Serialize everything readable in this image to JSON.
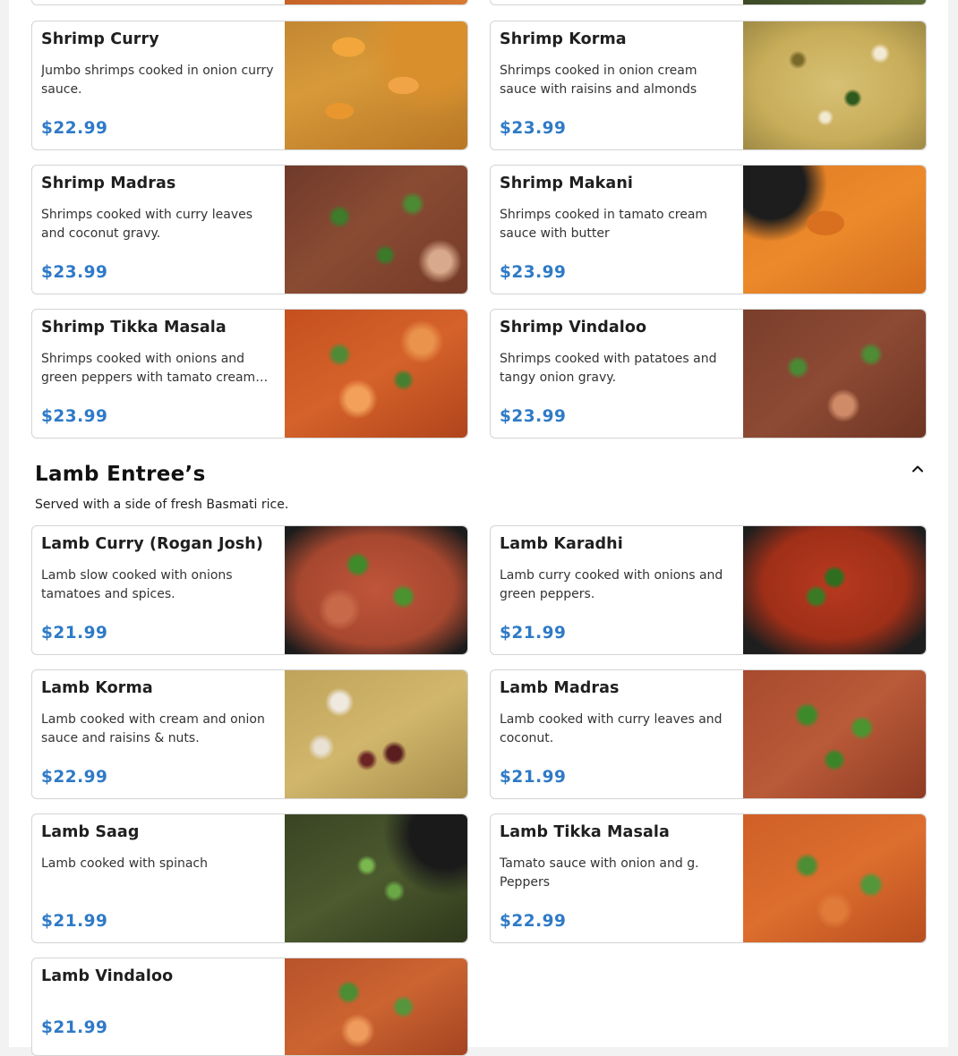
{
  "shrimp_items": [
    {
      "name": "Shrimp Curry",
      "desc": "Jumbo shrimps cooked in onion curry sauce.",
      "price": "$22.99",
      "photo": "shrimp-curry-photo"
    },
    {
      "name": "Shrimp Korma",
      "desc": "Shrimps cooked in onion cream sauce with raisins and almonds",
      "price": "$23.99",
      "photo": "shrimp-korma-photo"
    },
    {
      "name": "Shrimp Madras",
      "desc": "Shrimps cooked with curry leaves and coconut gravy.",
      "price": "$23.99",
      "photo": "shrimp-madras-photo"
    },
    {
      "name": "Shrimp Makani",
      "desc": "Shrimps cooked in tamato cream sauce with butter",
      "price": "$23.99",
      "photo": "shrimp-makani-photo"
    },
    {
      "name": "Shrimp Tikka Masala",
      "desc": "Shrimps cooked with onions and green peppers with tamato cream sauce",
      "price": "$23.99",
      "photo": "shrimp-tikka-masala-photo"
    },
    {
      "name": "Shrimp Vindaloo",
      "desc": "Shrimps cooked with patatoes and tangy onion gravy.",
      "price": "$23.99",
      "photo": "shrimp-vindaloo-photo"
    }
  ],
  "lamb_section": {
    "title": "Lamb Entree’s",
    "subtitle": "Served with a side of fresh Basmati rice.",
    "collapse_icon": "chevron-up-icon"
  },
  "lamb_items": [
    {
      "name": "Lamb Curry (Rogan Josh)",
      "desc": "Lamb slow cooked with onions tamatoes and spices.",
      "price": "$21.99",
      "photo": "lamb-curry-photo"
    },
    {
      "name": "Lamb Karadhi",
      "desc": "Lamb curry cooked with onions and green peppers.",
      "price": "$21.99",
      "photo": "lamb-karadhi-photo"
    },
    {
      "name": "Lamb Korma",
      "desc": "Lamb cooked with cream and onion sauce and raisins & nuts.",
      "price": "$22.99",
      "photo": "lamb-korma-photo"
    },
    {
      "name": "Lamb Madras",
      "desc": "Lamb cooked with curry leaves and coconut.",
      "price": "$21.99",
      "photo": "lamb-madras-photo"
    },
    {
      "name": "Lamb Saag",
      "desc": "Lamb cooked with spinach",
      "price": "$21.99",
      "photo": "lamb-saag-photo"
    },
    {
      "name": "Lamb Tikka Masala",
      "desc": "Tamato sauce with onion and g. Peppers",
      "price": "$22.99",
      "photo": "lamb-tikka-masala-photo"
    },
    {
      "name": "Lamb Vindaloo",
      "desc": "",
      "price": "$21.99",
      "photo": "lamb-vindaloo-photo"
    }
  ],
  "colors": {
    "price": "#2e7ac7",
    "card_border": "#d4d4d4",
    "page_bg": "#ffffff"
  }
}
